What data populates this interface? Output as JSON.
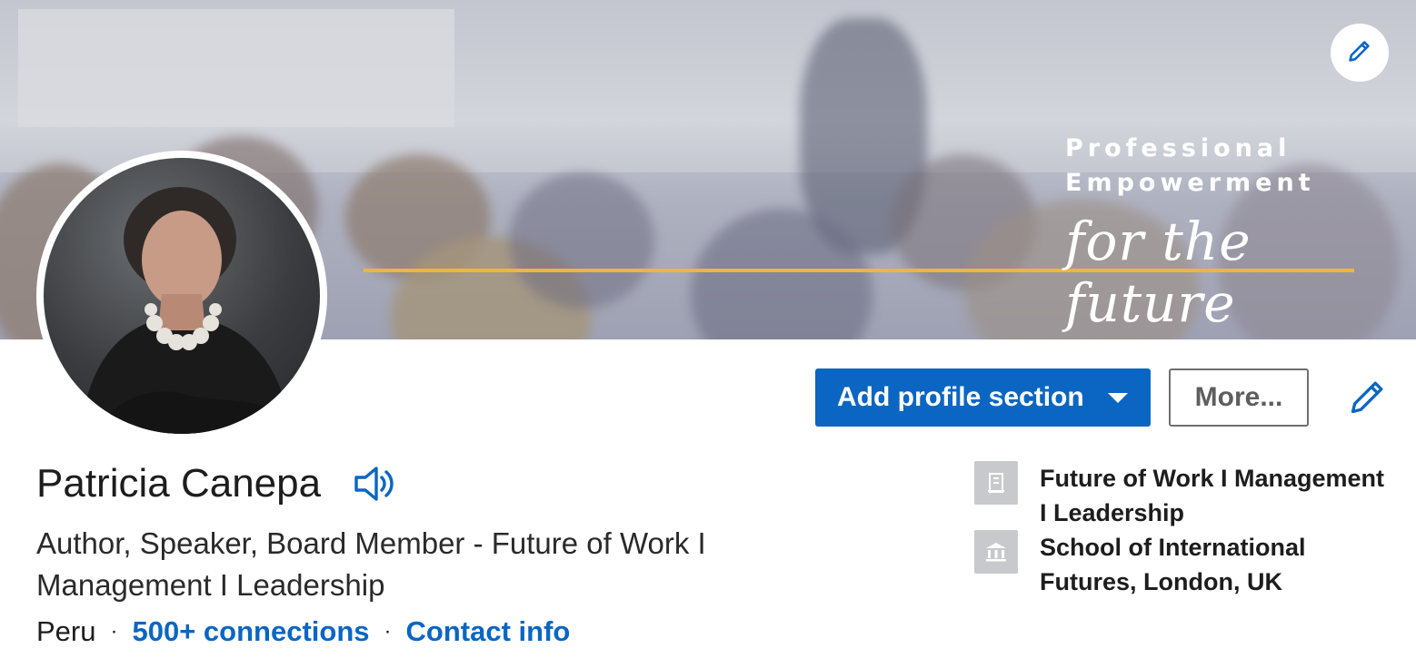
{
  "cover": {
    "tagline_line1": "Professional",
    "tagline_line2": "Empowerment",
    "tagline_script": "for the future",
    "accent_color": "#f2b43a"
  },
  "actions": {
    "add_section_label": "Add profile section",
    "more_label": "More..."
  },
  "profile": {
    "name": "Patricia Canepa",
    "headline": "Author, Speaker, Board Member - Future of Work I Management I Leadership",
    "location": "Peru",
    "separator": "·",
    "connections": "500+ connections",
    "contact": "Contact info"
  },
  "sidebar": {
    "items": [
      {
        "icon": "building-icon",
        "label": "Future of Work I Management I Leadership"
      },
      {
        "icon": "school-icon",
        "label": "School of International Futures, London, UK"
      }
    ]
  },
  "colors": {
    "brand": "#0a66c2"
  }
}
